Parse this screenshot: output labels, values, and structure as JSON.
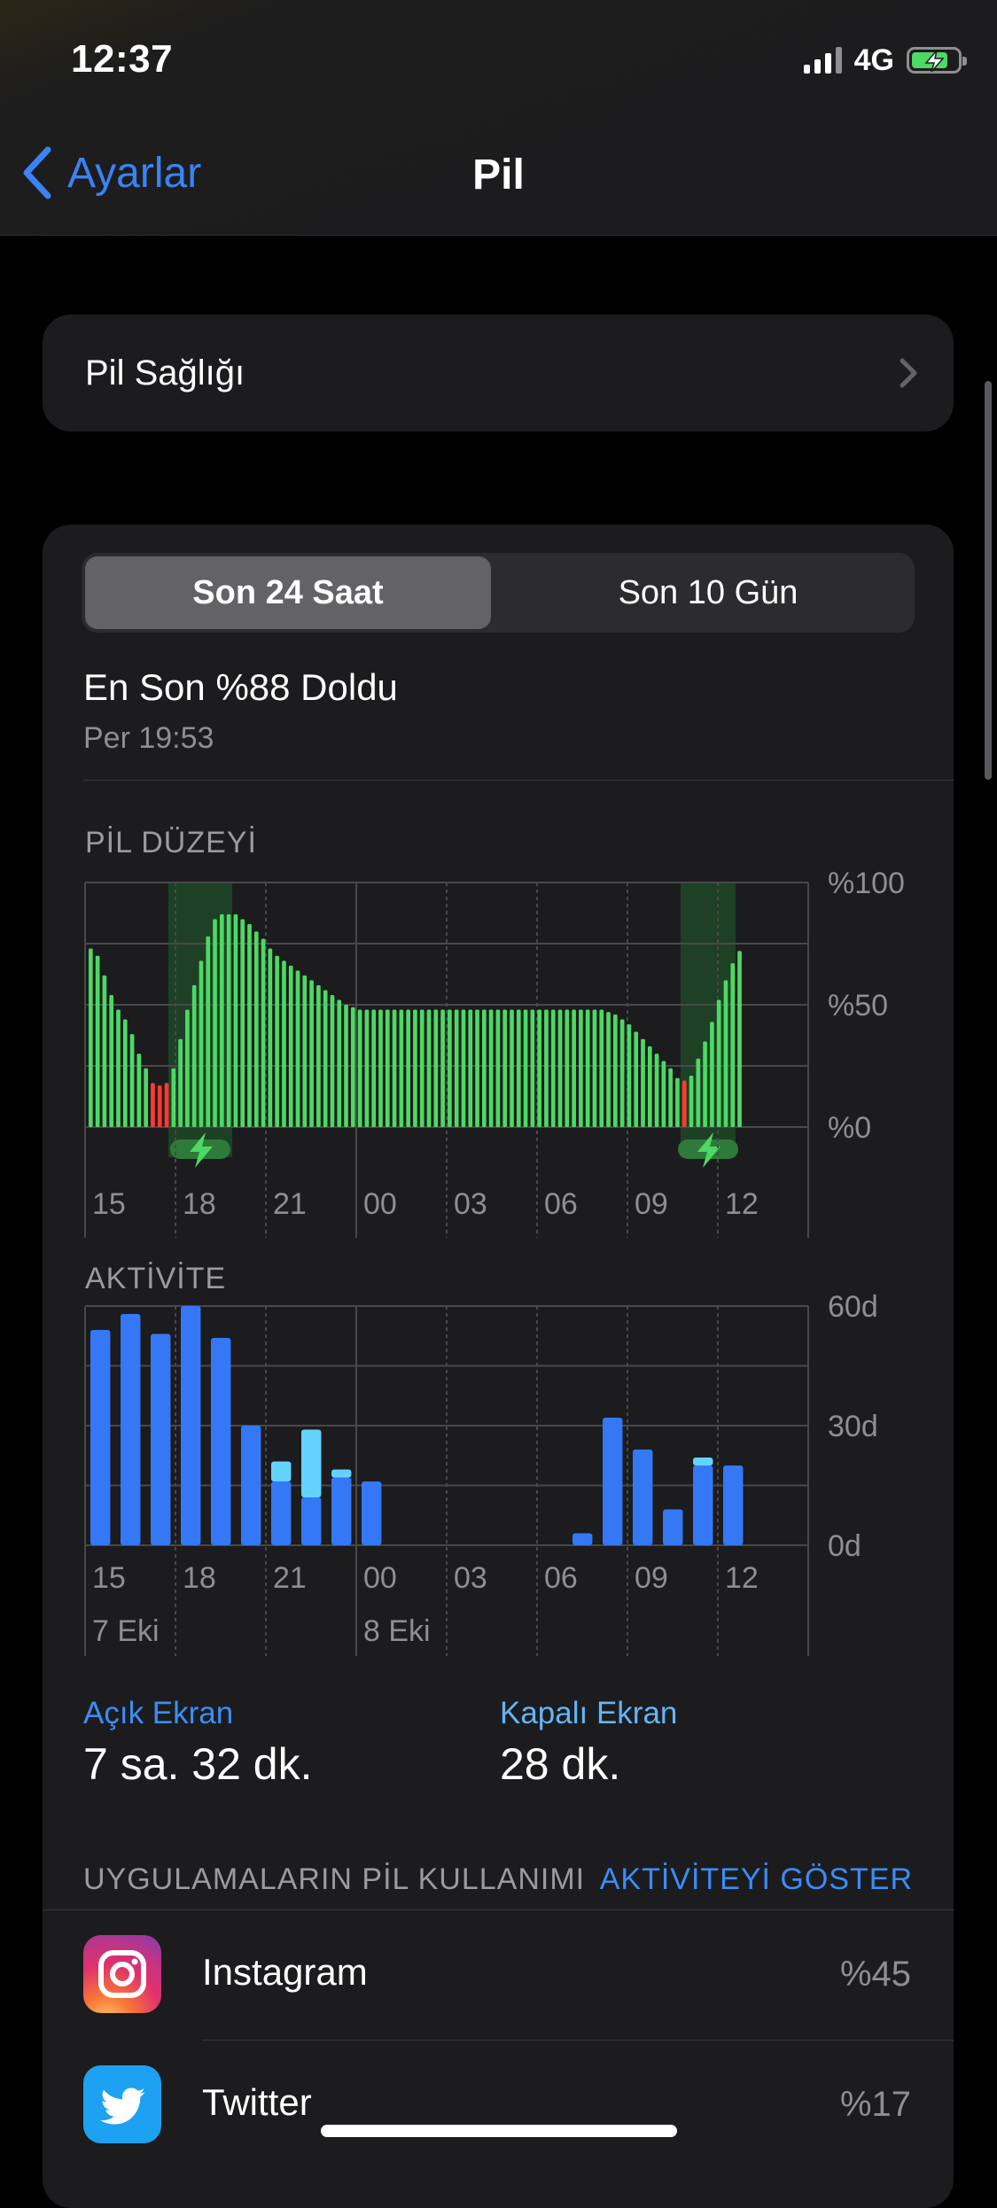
{
  "status_bar": {
    "time": "12:37",
    "network": "4G"
  },
  "nav": {
    "back_label": "Ayarlar",
    "title": "Pil"
  },
  "health": {
    "label": "Pil Sağlığı"
  },
  "segmented": {
    "options": [
      "Son 24 Saat",
      "Son 10 Gün"
    ],
    "selected": "Son 24 Saat"
  },
  "last_charge": {
    "title": "En Son %88 Doldu",
    "date": "Per 19:53"
  },
  "colors": {
    "accent": "#3a8ef6",
    "battery_green": "#4cd964",
    "battery_low": "#ff3b30",
    "screen_on": "#3478f6",
    "screen_off": "#64d2ff"
  },
  "chart_data": [
    {
      "type": "bar",
      "title": "PİL DÜZEYİ",
      "x_ticks": [
        "15",
        "18",
        "21",
        "00",
        "03",
        "06",
        "09",
        "12"
      ],
      "y_ticks": [
        "%100",
        "%50",
        "%0"
      ],
      "ylim": [
        0,
        100
      ],
      "values": [
        73,
        70,
        62,
        54,
        48,
        44,
        38,
        30,
        24,
        18,
        17,
        18,
        24,
        36,
        48,
        58,
        68,
        78,
        85,
        87,
        87,
        87,
        85,
        83,
        80,
        77,
        73,
        70,
        68,
        66,
        64,
        62,
        60,
        58,
        56,
        54,
        52,
        50,
        49,
        48,
        48,
        48,
        48,
        48,
        48,
        48,
        48,
        48,
        48,
        48,
        48,
        48,
        48,
        48,
        48,
        48,
        48,
        48,
        48,
        48,
        48,
        48,
        48,
        48,
        48,
        48,
        48,
        48,
        48,
        48,
        48,
        48,
        48,
        48,
        48,
        47,
        46,
        44,
        42,
        39,
        36,
        33,
        30,
        27,
        24,
        20,
        19,
        21,
        28,
        35,
        43,
        52,
        60,
        67,
        72
      ],
      "low_values_threshold": 20,
      "charging_icon": "charging-bolt-icon",
      "grid": true
    },
    {
      "type": "bar",
      "title": "AKTİVİTE",
      "x_ticks": [
        "15",
        "18",
        "21",
        "00",
        "03",
        "06",
        "09",
        "12"
      ],
      "date_labels": [
        "7 Eki",
        "8 Eki"
      ],
      "y_ticks": [
        "60d",
        "30d",
        "0d"
      ],
      "ylim": [
        0,
        60
      ],
      "series": [
        {
          "name": "Açık Ekran",
          "values": [
            54,
            58,
            53,
            60,
            52,
            30,
            16,
            12,
            17,
            16,
            0,
            0,
            0,
            0,
            0,
            0,
            3,
            32,
            24,
            9,
            20,
            20
          ]
        },
        {
          "name": "Kapalı Ekran",
          "values": [
            0,
            0,
            0,
            0,
            0,
            0,
            5,
            17,
            2,
            0,
            0,
            0,
            0,
            0,
            0,
            0,
            0,
            0,
            0,
            0,
            2,
            0
          ]
        }
      ],
      "grid": true
    }
  ],
  "stats": {
    "on_label": "Açık Ekran",
    "on_value": "7 sa. 32 dk.",
    "off_label": "Kapalı Ekran",
    "off_value": "28 dk."
  },
  "apps": {
    "header": "UYGULAMALARIN PİL KULLANIMI",
    "action": "AKTİVİTEYİ GÖSTER",
    "items": [
      {
        "name": "Instagram",
        "percent": "%45",
        "icon": "instagram-icon"
      },
      {
        "name": "Twitter",
        "percent": "%17",
        "icon": "twitter-icon"
      }
    ]
  }
}
